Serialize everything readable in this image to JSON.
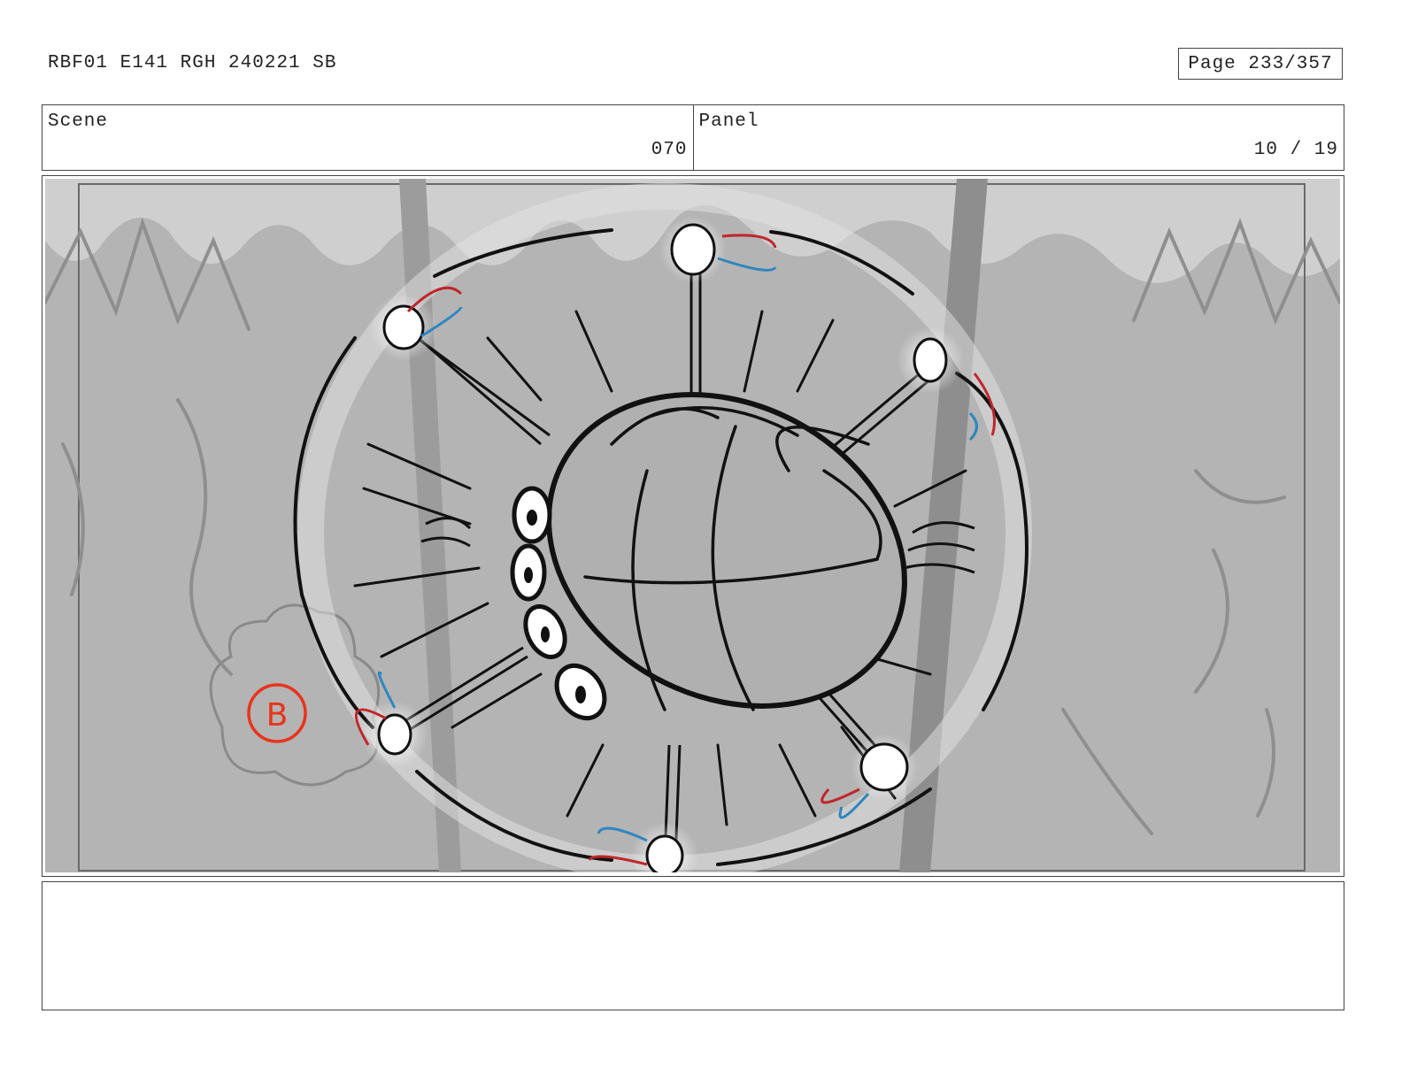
{
  "header": {
    "title": "RBF01 E141 RGH 240221 SB",
    "page": "Page 233/357"
  },
  "info": {
    "scene_label": "Scene",
    "scene_value": "070",
    "panel_label": "Panel",
    "panel_value": "10 / 19"
  },
  "panel_drawing": {
    "marker_letter": "B",
    "colors": {
      "background": "#b4b4b4",
      "sky": "#cfcfcf",
      "ink": "#111111",
      "red_accent": "#c0262a",
      "blue_accent": "#2f86c0",
      "marker": "#e8341c"
    }
  },
  "notes": {
    "text": ""
  }
}
